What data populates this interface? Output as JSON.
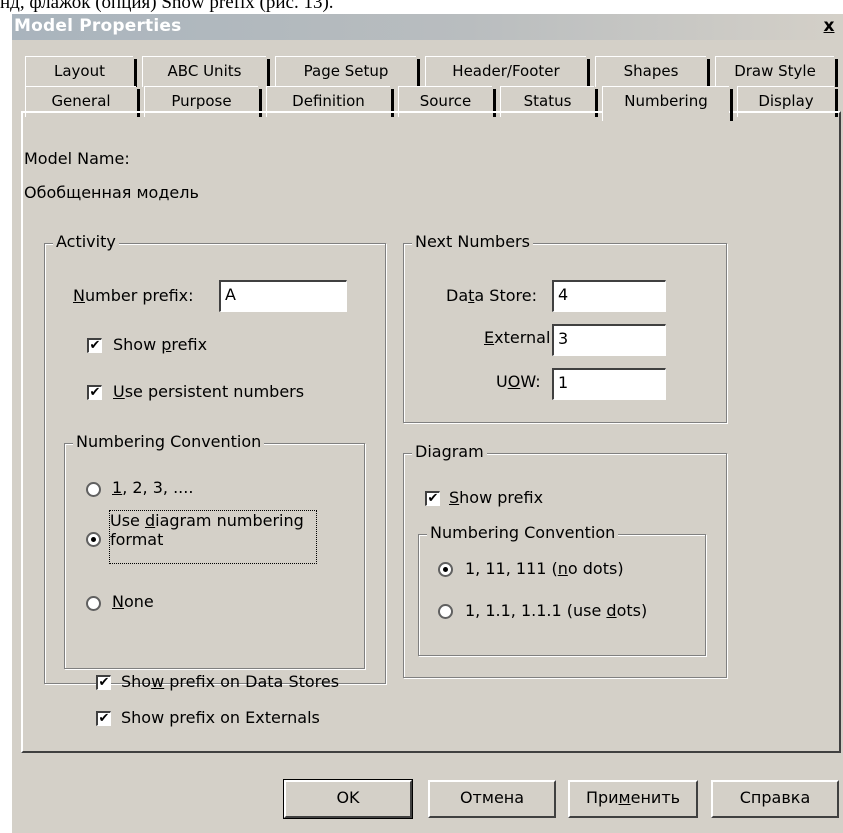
{
  "caption": "нд, флажок (опция) Show prefix (рис. 13).",
  "window": {
    "title": "Model Properties",
    "close": "x"
  },
  "tabs_row1": [
    "Layout",
    "ABC Units",
    "Page Setup",
    "Header/Footer",
    "Shapes",
    "Draw Style"
  ],
  "tabs_row2": [
    "General",
    "Purpose",
    "Definition",
    "Source",
    "Status",
    "Numbering",
    "Display"
  ],
  "selected_tab": "Numbering",
  "model_name": {
    "label": "Model Name:",
    "value": "Обобщенная модель"
  },
  "activity": {
    "legend": "Activity",
    "number_prefix_label": "Number prefix:",
    "number_prefix_value": "A",
    "show_prefix": {
      "label": "Show prefix",
      "checked": true
    },
    "use_persistent": {
      "label": "Use persistent numbers",
      "checked": true
    },
    "convention": {
      "legend": "Numbering Convention",
      "opt1": "1, 2, 3, ....",
      "opt2_line1": "Use diagram numbering",
      "opt2_line2": "format",
      "opt3": "None",
      "selected": "Use diagram numbering format"
    }
  },
  "next_numbers": {
    "legend": "Next Numbers",
    "data_store_label": "Data Store:",
    "data_store_value": "4",
    "external_label": "External:",
    "external_value": "3",
    "uow_label": "UOW:",
    "uow_value": "1"
  },
  "diagram": {
    "legend": "Diagram",
    "show_prefix": {
      "label": "Show prefix",
      "checked": true
    },
    "convention": {
      "legend": "Numbering Convention",
      "opt1": "1, 11, 111 (no dots)",
      "opt2": "1, 1.1, 1.1.1 (use dots)",
      "selected": "1, 11, 111 (no dots)"
    }
  },
  "show_prefix_data_stores": {
    "label": "Show prefix on Data Stores",
    "checked": true
  },
  "show_prefix_externals": {
    "label": "Show prefix on Externals",
    "checked": true
  },
  "buttons": {
    "ok": "OK",
    "cancel": "Отмена",
    "apply": "Применить",
    "help": "Справка"
  },
  "check_mark": "✔"
}
